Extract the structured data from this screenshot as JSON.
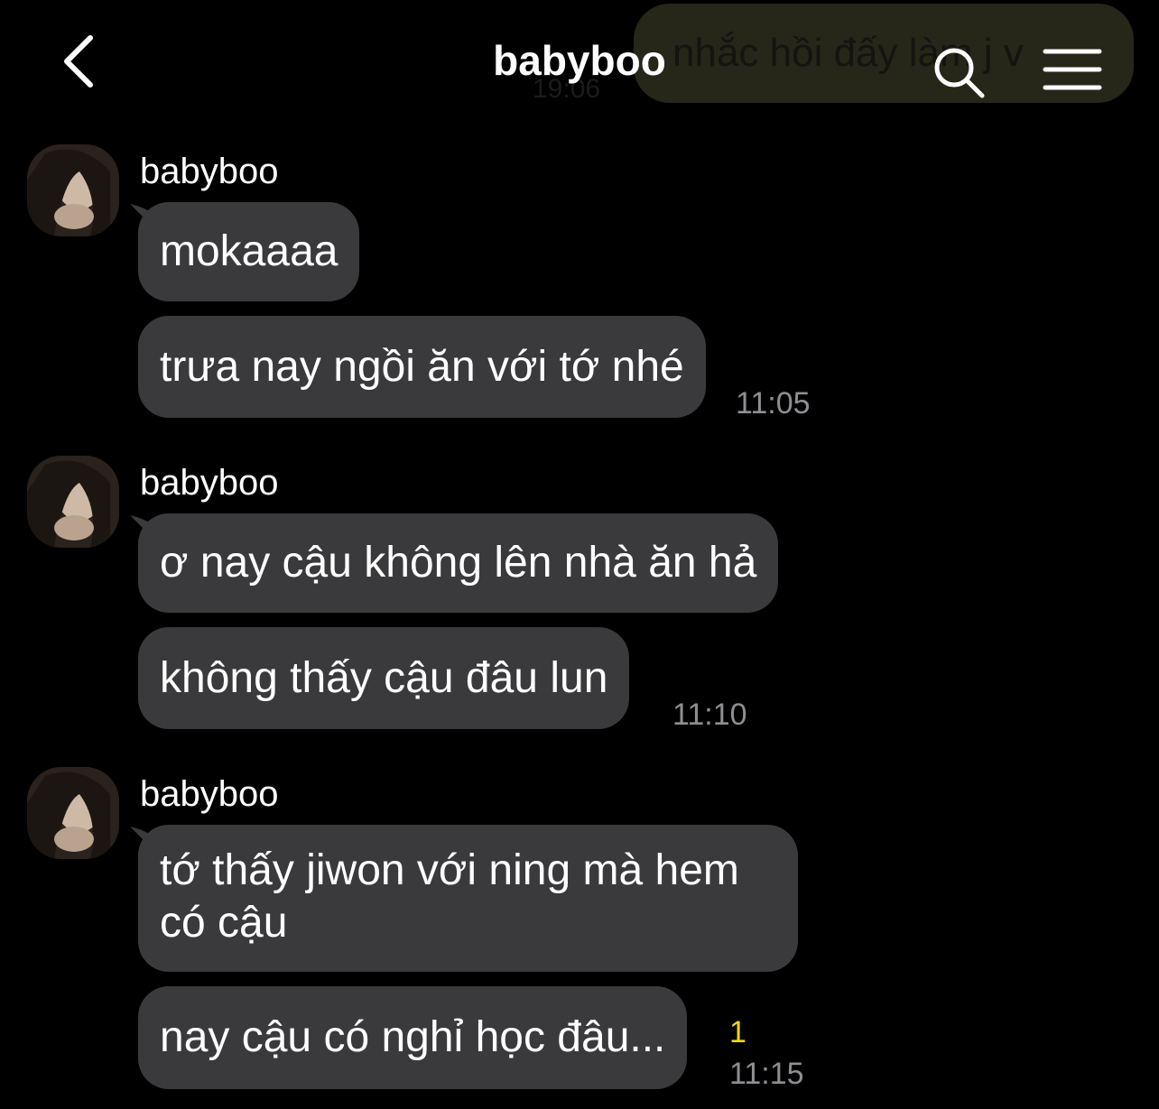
{
  "header": {
    "title": "babyboo",
    "ghost_text": "nhắc hồi đấy làm j v",
    "ghost_time": "19:06"
  },
  "colors": {
    "background": "#000000",
    "bubble": "#3a3a3c",
    "timestamp": "#8e8e93",
    "unread": "#f5d90a"
  },
  "groups": [
    {
      "sender": "babyboo",
      "messages": [
        "mokaaaa",
        "trưa nay ngồi ăn với tớ nhé"
      ],
      "time": "11:05"
    },
    {
      "sender": "babyboo",
      "messages": [
        "ơ nay cậu không lên nhà ăn hả",
        "không thấy cậu đâu lun"
      ],
      "time": "11:10"
    },
    {
      "sender": "babyboo",
      "messages": [
        "tớ thấy jiwon với ning mà hem có cậu",
        "nay cậu có nghỉ học đâu..."
      ],
      "time": "11:15",
      "unread": "1"
    }
  ]
}
